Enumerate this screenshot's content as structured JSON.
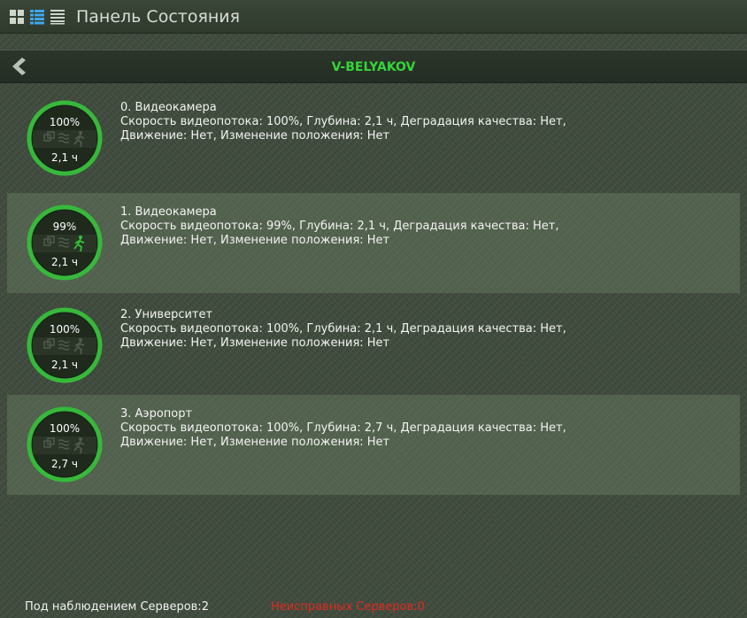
{
  "window": {
    "title": "Панель Состояния"
  },
  "toolbar": {
    "view_icons": [
      "grid-view-icon",
      "list-view-icon",
      "compact-list-icon"
    ],
    "back_icon": "chevron-left-icon"
  },
  "server": {
    "name": "V-BELYAKOV"
  },
  "cameras": [
    {
      "name": "0. Видеокамера",
      "details_line1": "Скорость видеопотока: 100%, Глубина: 2,1 ч, Деградация качества: Нет,",
      "details_line2": "Движение: Нет, Изменение положения: Нет",
      "rate": "100%",
      "depth": "2,1 ч",
      "motion_active": false
    },
    {
      "name": "1. Видеокамера",
      "details_line1": "Скорость видеопотока: 99%, Глубина: 2,1 ч, Деградация качества: Нет,",
      "details_line2": "Движение: Нет, Изменение положения: Нет",
      "rate": "99%",
      "depth": "2,1 ч",
      "motion_active": true
    },
    {
      "name": "2. Университет",
      "details_line1": "Скорость видеопотока: 100%, Глубина: 2,1 ч, Деградация качества: Нет,",
      "details_line2": "Движение: Нет, Изменение положения: Нет",
      "rate": "100%",
      "depth": "2,1 ч",
      "motion_active": false
    },
    {
      "name": "3. Аэропорт",
      "details_line1": "Скорость видеопотока: 100%, Глубина: 2,7 ч, Деградация качества: Нет,",
      "details_line2": "Движение: Нет, Изменение положения: Нет",
      "rate": "100%",
      "depth": "2,7 ч",
      "motion_active": false
    }
  ],
  "status": {
    "watched": "Под наблюдением Серверов:2",
    "faulty": "Неисправных Серверов:0"
  },
  "colors": {
    "accent_green": "#35d43a",
    "error_red": "#e02a22",
    "gauge_ring": "#36b93a",
    "motion_active": "#30c436"
  }
}
